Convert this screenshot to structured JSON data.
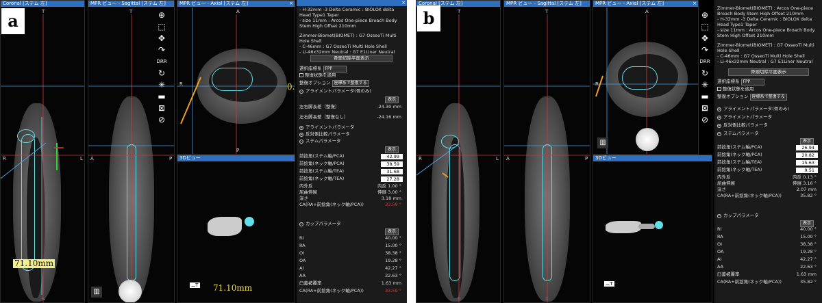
{
  "figure_a": {
    "label": "a",
    "views": {
      "coronal_title": "Coronal [ステム 左]",
      "sagittal_title": "MPR ビュー - Sagittal [ステム 左]",
      "axial_title": "MPR ビュー - Axial [ステム 左]",
      "view3d_title": "3Dビュー"
    },
    "orient": {
      "t": "T",
      "b": "B",
      "r": "R",
      "l": "L",
      "a": "A",
      "p": "P"
    },
    "measure_coronal": "71.10mm",
    "measure_3d": "71.10mm",
    "axial_small_label": "0.",
    "view3d_tag": "⚊T",
    "implant_text": [
      "- H-32mm -3 Delta Ceramic : BIOLOX delta",
      "  Head Type1 Taper",
      "- size 11mm : Arcos One-piece Broach Body",
      "  Stem High Offset 210mm",
      "",
      "Zimmer-Biomet(BIOMET) : G7 OsseoTi Multi",
      "Hole Shell",
      "- C-46mm : G7 OsseoTi Multi Hole Shell",
      "- Li-46x32mm Neutral : G7 E1Liner Neutral"
    ],
    "button_resection": "骨頭切除平面表示",
    "coord_label": "選択座標系",
    "coord_value": "FPP",
    "check_label": "整復状態を適用",
    "reduce_option_label": "整復オプション",
    "reduce_option_value": "座標系で整復する",
    "sec_alignment": "アライメントパラメータ(骨のみ)",
    "show_label": "表示",
    "alignment_rows": [
      {
        "label": "左右脚長差（整復）",
        "value": "-24.30 mm"
      },
      {
        "label": "左右脚長差（整復なし）",
        "value": "-24.16 mm"
      }
    ],
    "sec_alignment2": "アライメントパラメータ",
    "sec_offset": "反対側比較パラメータ",
    "sec_stem": "ステムパラメータ",
    "stem_rows": [
      {
        "label": "前捻角(ステム軸/PCA)",
        "value": "42.99"
      },
      {
        "label": "前捻角(ネック軸/PCA)",
        "value": "38.59"
      },
      {
        "label": "前捻角(ステム軸/TEA)",
        "value": "31.68"
      },
      {
        "label": "前捻角(ネック軸/TEA)",
        "value": "27.28"
      }
    ],
    "stem_plain_rows": [
      {
        "label": "内外反",
        "value": "内反 1.00 °"
      },
      {
        "label": "屈曲伸展",
        "value": "伸展 3.00 °"
      },
      {
        "label": "深さ",
        "value": "3.18 mm"
      }
    ],
    "ca_label": "CA(RA+前捻角(ネック軸/PCA))",
    "ca_value": "33.59 °",
    "sec_cup": "カップパラメータ",
    "cup_rows": [
      {
        "label": "RI",
        "value": "40.00 °"
      },
      {
        "label": "RA",
        "value": "15.00 °"
      },
      {
        "label": "OI",
        "value": "38.38 °"
      },
      {
        "label": "OA",
        "value": "19.28 °"
      },
      {
        "label": "AI",
        "value": "42.27 °"
      },
      {
        "label": "AA",
        "value": "22.63 °"
      },
      {
        "label": "臼蓋被覆率",
        "value": "1.63 mm"
      }
    ],
    "cup_ca_label": "CA(RA+前捻角(ネック軸/PCA))",
    "cup_ca_value": "33.59 °"
  },
  "figure_b": {
    "label": "b",
    "views": {
      "coronal_title": "Coronal [ステム 左]",
      "sagittal_title": "MPR ビュー - Sagittal [ステム 左]",
      "axial_title": "MPR ビュー - Axial [ステム 左]",
      "view3d_title": "3Dビュー"
    },
    "orient": {
      "t": "T",
      "b": "B",
      "r": "R",
      "l": "L",
      "a": "A",
      "p": "P"
    },
    "view3d_tag": "⚊T",
    "implant_text": [
      "Zimmer-Biomet(BIOMET) : Arcos One-piece",
      "Broach Body Stem High Offset 210mm",
      "- H-32mm -3 Delta Ceramic : BIOLOX delta",
      "  Head Type1 Taper",
      "- size 11mm : Arcos One-piece Broach Body",
      "  Stem High Offset 210mm",
      "",
      "Zimmer-Biomet(BIOMET) : G7 OsseoTi Multi",
      "Hole Shell",
      "- C-46mm : G7 OsseoTi Multi Hole Shell",
      "- Li-46x32mm Neutral : G7 E1Liner Neutral"
    ],
    "button_resection": "骨頭切除平面表示",
    "coord_label": "選択座標系",
    "coord_value": "FPP",
    "check_label": "整復状態を適用",
    "reduce_option_label": "整復オプション",
    "reduce_option_value": "座標系で整復する",
    "sec_alignment": "アライメントパラメータ(骨のみ)",
    "sec_alignment2": "アライメントパラメータ",
    "sec_offset": "反対側比較パラメータ",
    "sec_stem": "ステムパラメータ",
    "show_label": "表示",
    "stem_rows": [
      {
        "label": "前捻角(ステム軸/PCA)",
        "value": "26.94"
      },
      {
        "label": "前捻角(ネック軸/PCA)",
        "value": "20.82"
      },
      {
        "label": "前捻角(ステム軸/TEA)",
        "value": "15.63"
      },
      {
        "label": "前捻角(ネック軸/TEA)",
        "value": "9.51"
      }
    ],
    "stem_plain_rows": [
      {
        "label": "内外反",
        "value": "内反 0.13 °"
      },
      {
        "label": "屈曲伸展",
        "value": "伸展 3.16 °"
      },
      {
        "label": "深さ",
        "value": "2.07 mm"
      }
    ],
    "ca_label": "CA(RA+前捻角(ネック軸/PCA))",
    "ca_value": "35.82 °",
    "sec_cup": "カップパラメータ",
    "cup_rows": [
      {
        "label": "RI",
        "value": "40.00 °"
      },
      {
        "label": "RA",
        "value": "15.00 °"
      },
      {
        "label": "OI",
        "value": "38.38 °"
      },
      {
        "label": "OA",
        "value": "19.28 °"
      },
      {
        "label": "AI",
        "value": "42.27 °"
      },
      {
        "label": "AA",
        "value": "22.63 °"
      },
      {
        "label": "臼蓋被覆率",
        "value": "1.63 mm"
      }
    ],
    "cup_ca_label": "CA(RA+前捻角(ネック軸/PCA))",
    "cup_ca_value": "35.82 °"
  },
  "icons": [
    "zoom-in-icon",
    "window-level-icon",
    "pan-icon",
    "rotate-icon",
    "drr-icon",
    "rotate-3d-icon",
    "crosshair-icon",
    "ruler-icon",
    "reset-icon",
    "cancel-icon"
  ],
  "colors": {
    "titlebar": "#2d6fbf",
    "stem_outline": "#66e0e8",
    "ref_line_blue": "#4aa3e8",
    "ref_line_red": "#d13a3a",
    "measure_bg": "#f2f08a",
    "orange_line": "#f0a020"
  }
}
